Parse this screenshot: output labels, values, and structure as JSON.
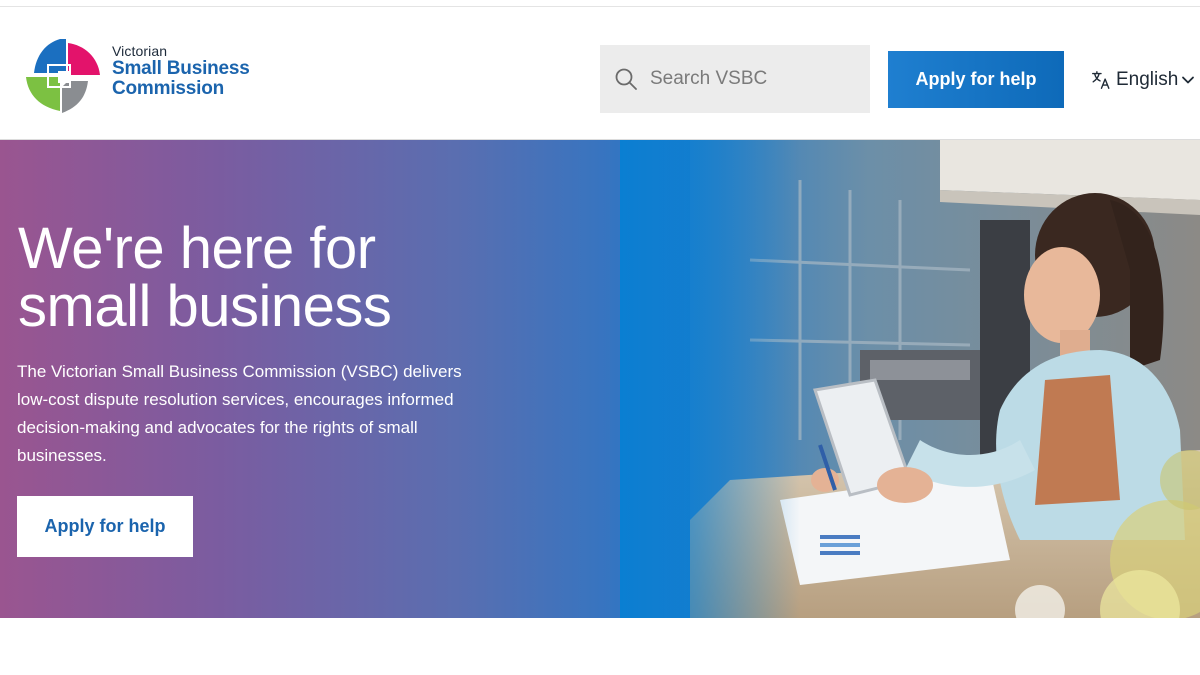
{
  "logo": {
    "line1": "Victorian",
    "line2": "Small Business",
    "line3": "Commission"
  },
  "search": {
    "placeholder": "Search VSBC",
    "value": ""
  },
  "header": {
    "apply_label": "Apply for help"
  },
  "language": {
    "label": "English"
  },
  "hero": {
    "title_line1": "We're here for",
    "title_line2": "small business",
    "description": "The Victorian Small Business Commission (VSBC) delivers low-cost dispute resolution services, encourages informed decision-making and advocates for the rights of small businesses.",
    "button_label": "Apply for help"
  },
  "colors": {
    "brand_blue": "#1b64ad",
    "button_blue": "#1377c6",
    "gradient_purple": "#9a5590",
    "gradient_blue": "#0a7fd2"
  }
}
